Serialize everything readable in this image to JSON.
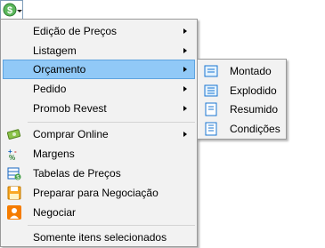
{
  "toolbar": {
    "icon": "dollar-price-icon"
  },
  "menu": {
    "items": [
      {
        "label": "Edição de Preços",
        "submenu": true
      },
      {
        "label": "Listagem",
        "submenu": true
      },
      {
        "label": "Orçamento",
        "submenu": true,
        "highlighted": true
      },
      {
        "label": "Pedido",
        "submenu": true
      },
      {
        "label": "Promob Revest",
        "submenu": true
      },
      {
        "label": "Comprar Online",
        "submenu": true,
        "icon": "money-icon"
      },
      {
        "label": "Margens",
        "icon": "margins-icon"
      },
      {
        "label": "Tabelas de Preços",
        "icon": "price-table-icon"
      },
      {
        "label": "Preparar para Negociação",
        "icon": "save-icon"
      },
      {
        "label": "Negociar",
        "icon": "person-icon"
      },
      {
        "label": "Somente itens selecionados"
      }
    ]
  },
  "submenu": {
    "items": [
      {
        "label": "Montado",
        "icon": "assembled-icon"
      },
      {
        "label": "Explodido",
        "icon": "exploded-icon"
      },
      {
        "label": "Resumido",
        "icon": "summary-icon"
      },
      {
        "label": "Condições",
        "icon": "conditions-icon"
      }
    ]
  },
  "colors": {
    "highlight": "#91c9f7",
    "menu_bg": "#f2f2f2",
    "accent_green": "#3a9a3a"
  }
}
